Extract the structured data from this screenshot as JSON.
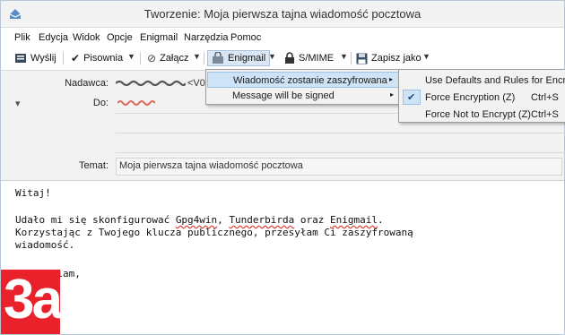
{
  "window": {
    "title": "Tworzenie: Moja pierwsza tajna wiadomość pocztowa"
  },
  "menubar": {
    "items": [
      "Plik",
      "Edycja",
      "Widok",
      "Opcje",
      "Enigmail",
      "Narzędzia",
      "Pomoc"
    ]
  },
  "toolbar": {
    "send": "Wyślij",
    "spelling": "Pisownia",
    "attach": "Załącz",
    "enigmail": "Enigmail",
    "smime": "S/MIME",
    "save_as": "Zapisz jako"
  },
  "header": {
    "from_label": "Nadawca:",
    "from_value_suffix": "<V0",
    "to_label": "Do:",
    "subject_label": "Temat:",
    "subject_value": "Moja pierwsza tajna wiadomość pocztowa",
    "collapse_glyph": "▾"
  },
  "enigmail_menu": {
    "items": [
      {
        "label": "Wiadomość zostanie zaszyfrowana",
        "arrow": "▸"
      },
      {
        "label": "Message will be signed",
        "arrow": "▸"
      }
    ]
  },
  "encryption_submenu": {
    "items": [
      {
        "label": "Use Defaults and Rules for Encryp",
        "shortcut": ""
      },
      {
        "label": "Force Encryption (Z)",
        "shortcut": "Ctrl+S",
        "checked": true,
        "check_glyph": "✔"
      },
      {
        "label": "Force Not to Encrypt (Z)",
        "shortcut": "Ctrl+S"
      }
    ]
  },
  "body": {
    "greeting": "Witaj!",
    "line1_a": "Udało mi się skonfigurować ",
    "line1_b": "Gpg4win",
    "line1_c": ", ",
    "line1_d": "Tunderbirda",
    "line1_e": " oraz ",
    "line1_f": "Enigmail",
    "line1_g": ".",
    "line2": "Korzystając z Twojego klucza publicznego, przesyłam Ci zaszyfrowaną",
    "line3": "wiadomość.",
    "closing": "Pozdrawiam,"
  },
  "badge": {
    "text": "3a"
  },
  "colors": {
    "badge": "#e8212b",
    "highlight": "#cfe3f6",
    "header_bg": "#f2f2f2"
  }
}
